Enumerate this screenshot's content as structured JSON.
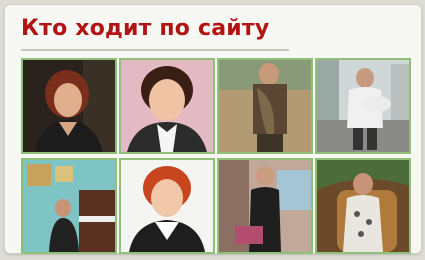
{
  "widget": {
    "title": "Кто ходит по сайту",
    "avatars": [
      {
        "name": "member-1"
      },
      {
        "name": "member-2"
      },
      {
        "name": "member-3"
      },
      {
        "name": "member-4"
      },
      {
        "name": "member-5"
      },
      {
        "name": "member-6"
      },
      {
        "name": "member-7"
      },
      {
        "name": "member-8"
      }
    ]
  },
  "colors": {
    "title": "#b21414",
    "tile_border": "#8fbf78",
    "panel": "#f7f7f3"
  }
}
